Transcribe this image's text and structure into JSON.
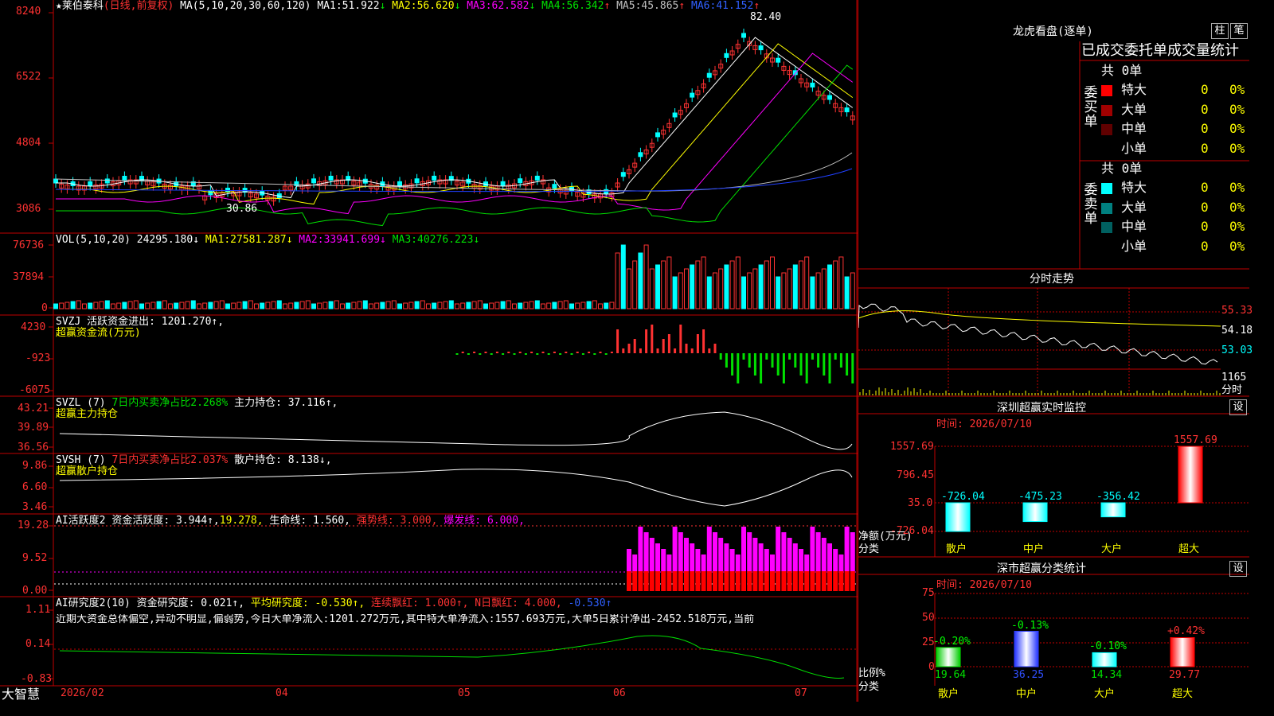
{
  "stock": {
    "name": "★莱伯泰科",
    "mode": "(日线,前复权)",
    "ma_label": "MA(5,10,20,30,60,120)",
    "ma": [
      {
        "label": "MA1:",
        "value": "51.922",
        "arrow": "↓",
        "color": "#ffffff"
      },
      {
        "label": "MA2:",
        "value": "56.620",
        "arrow": "↓",
        "color": "#ffff00"
      },
      {
        "label": "MA3:",
        "value": "62.582",
        "arrow": "↓",
        "color": "#ff00ff"
      },
      {
        "label": "MA4:",
        "value": "56.342",
        "arrow": "↑",
        "color": "#00e000"
      },
      {
        "label": "MA5:",
        "value": "45.865",
        "arrow": "↑",
        "color": "#c0c0c0"
      },
      {
        "label": "MA6:",
        "value": "41.152",
        "arrow": "↑",
        "color": "#3050ff"
      }
    ],
    "price_axis": [
      "8240",
      "6522",
      "4804",
      "3086"
    ],
    "high_label": "82.40",
    "low_label": "30.86"
  },
  "vol": {
    "header": "VOL(5,10,20)",
    "value": "24295.180↓",
    "ma": [
      {
        "label": "MA1:",
        "value": "27581.287↓",
        "color": "#ffff00"
      },
      {
        "label": "MA2:",
        "value": "33941.699↓",
        "color": "#ff00ff"
      },
      {
        "label": "MA3:",
        "value": "40276.223↓",
        "color": "#00e000"
      }
    ],
    "axis": [
      "76736",
      "37894",
      "0"
    ]
  },
  "svzj": {
    "header": "SVZJ  活跃资金进出: 1201.270↑,",
    "sub": "超赢资金流(万元)",
    "axis": [
      "4230",
      "-923",
      "-6075"
    ]
  },
  "svzl": {
    "header_a": "SVZL (7)",
    "header_b": "7日内买卖净占比2.268%",
    "header_c": "主力持仓: 37.116↑,",
    "sub": "超赢主力持仓",
    "axis": [
      "43.21",
      "39.89",
      "36.56"
    ]
  },
  "svsh": {
    "header_a": "SVSH (7)",
    "header_b": "7日内买卖净占比2.037%",
    "header_c": "散户持仓: 8.138↓,",
    "sub": "超赢散户持仓",
    "axis": [
      "9.86",
      "6.60",
      "3.46"
    ]
  },
  "ai_active": {
    "header_a": "AI活跃度2",
    "header_b": "资金活跃度: 3.944↑,",
    "header_c": "19.278,",
    "header_d": "生命线: 1.560,",
    "header_e": "强势线: 3.000,",
    "header_f": "爆发线: 6.000,",
    "axis": [
      "19.28",
      "9.52",
      "0.00"
    ]
  },
  "ai_research": {
    "header_a": "AI研究度2(10)",
    "header_b": "资金研究度: 0.021↑,",
    "header_c": "平均研究度: -0.530↑,",
    "header_d": "连续飘红: 1.000↑,",
    "header_e": "N日飘红: 4.000,",
    "header_f": "-0.530↑",
    "text": "近期大资金总体偏空,异动不明显,偏弱势,今日大单净流入:1201.272万元,其中特大单净流入:1557.693万元,大单5日累计净出-2452.518万元,当前",
    "axis": [
      "1.11",
      "0.14",
      "-0.83"
    ]
  },
  "date_axis": {
    "brand": "大智慧",
    "labels": [
      "2026/02",
      "04",
      "05",
      "06",
      "07"
    ]
  },
  "right_panel": {
    "title": "龙虎看盘(逐单)",
    "btn_zhu": "柱",
    "btn_bi": "笔",
    "tab_header": "已成交委托单成交量统计",
    "buy": {
      "side_label": "委买单",
      "total": "共 0单",
      "rows": [
        {
          "label": "特大",
          "count": "0",
          "pct": "0%",
          "color": "#ff0000"
        },
        {
          "label": "大单",
          "count": "0",
          "pct": "0%",
          "color": "#a00000"
        },
        {
          "label": "中单",
          "count": "0",
          "pct": "0%",
          "color": "#600000"
        },
        {
          "label": "小单",
          "count": "0",
          "pct": "0%",
          "color": ""
        }
      ]
    },
    "sell": {
      "side_label": "委卖单",
      "total": "共 0单",
      "rows": [
        {
          "label": "特大",
          "count": "0",
          "pct": "0%",
          "color": "#00ffff"
        },
        {
          "label": "大单",
          "count": "0",
          "pct": "0%",
          "color": "#008080"
        },
        {
          "label": "中单",
          "count": "0",
          "pct": "0%",
          "color": "#006060"
        },
        {
          "label": "小单",
          "count": "0",
          "pct": "0%",
          "color": ""
        }
      ]
    },
    "intraday": {
      "title": "分时走势",
      "axis": [
        "55.33",
        "54.18",
        "53.03",
        "1165"
      ],
      "axis_footer": "分时"
    },
    "monitor": {
      "title": "深圳超赢实时监控",
      "settings_label": "设",
      "time": "时间: 2026/07/10",
      "axis": [
        "1557.69",
        "796.45",
        "35.0",
        "-726.04"
      ],
      "unit_label": "净额(万元)",
      "class_label": "分类",
      "bars": [
        {
          "category": "散户",
          "value": -726.04,
          "label": "-726.04"
        },
        {
          "category": "中户",
          "value": -475.23,
          "label": "-475.23"
        },
        {
          "category": "大户",
          "value": -356.42,
          "label": "-356.42"
        },
        {
          "category": "超大",
          "value": 1557.69,
          "label": "1557.69"
        }
      ]
    },
    "classify": {
      "title": "深市超赢分类统计",
      "settings_label": "设",
      "time": "时间: 2026/07/10",
      "axis": [
        "75",
        "50",
        "25",
        "0"
      ],
      "ratio_label": "比例%",
      "class_label": "分类",
      "bars": [
        {
          "category": "散户",
          "value": 19.64,
          "label": "19.64",
          "delta": "-0.20%"
        },
        {
          "category": "中户",
          "value": 36.25,
          "label": "36.25",
          "delta": "-0.13%"
        },
        {
          "category": "大户",
          "value": 14.34,
          "label": "14.34",
          "delta": "-0.10%"
        },
        {
          "category": "超大",
          "value": 29.77,
          "label": "29.77",
          "delta": "+0.42%"
        }
      ]
    }
  }
}
